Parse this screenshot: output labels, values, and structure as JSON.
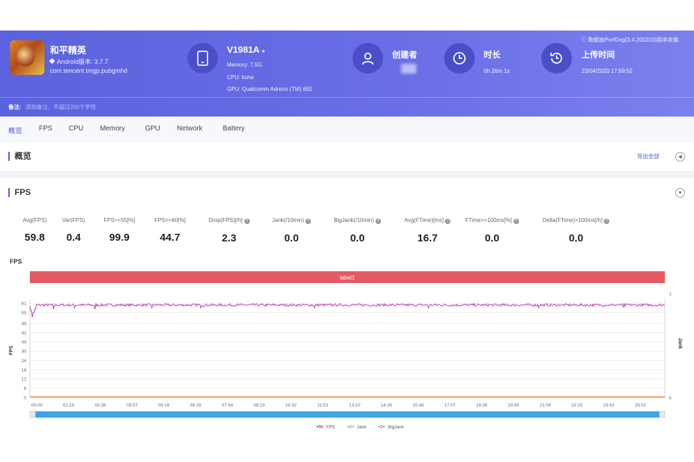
{
  "app": {
    "name": "和平精英",
    "android_version": "Android版本: 3.7.7",
    "package": "com.tencent.tmgp.pubgmhd"
  },
  "device": {
    "name": "V1981A",
    "memory": "Memory: 7.5G",
    "cpu": "CPU: kona",
    "gpu": "GPU: Qualcomm Adreno (TM) 650"
  },
  "creator": {
    "label": "创建者"
  },
  "duration": {
    "label": "时长",
    "value": "0h 26m 1s"
  },
  "upload": {
    "label": "上传时间",
    "value": "22/04/2020 17:59:52"
  },
  "source_note": "数据由PerfDog(3.4.200310)版本收集",
  "remark": {
    "label": "备注:",
    "placeholder": "添加备注，不超过200个字符"
  },
  "tabs": [
    {
      "label": "概览"
    },
    {
      "label": "FPS"
    },
    {
      "label": "CPU"
    },
    {
      "label": "Memory"
    },
    {
      "label": "GPU"
    },
    {
      "label": "Network"
    },
    {
      "label": "Battery"
    }
  ],
  "overview": {
    "title": "概览",
    "export_label": "导出全部"
  },
  "fps_section": {
    "title": "FPS"
  },
  "stats": [
    {
      "label": "Avg(FPS)",
      "value": "59.8",
      "help": false
    },
    {
      "label": "Var(FPS)",
      "value": "0.4",
      "help": false
    },
    {
      "label": "FPS>=55[%]",
      "value": "99.9",
      "help": false
    },
    {
      "label": "FPS>=60[%]",
      "value": "44.7",
      "help": false
    },
    {
      "label": "Drop(FPS)[/h]",
      "value": "2.3",
      "help": true
    },
    {
      "label": "Jank(/10min)",
      "value": "0.0",
      "help": true
    },
    {
      "label": "BigJank(/10min)",
      "value": "0.0",
      "help": true
    },
    {
      "label": "Avg(FTime)[ms]",
      "value": "16.7",
      "help": true
    },
    {
      "label": "FTime>=100ms[%]",
      "value": "0.0",
      "help": true
    },
    {
      "label": "Delta(FTime)>100ms[/h]",
      "value": "0.0",
      "help": true
    }
  ],
  "colors": {
    "accent": "#4a57d8",
    "fps_line": "#c13ab6",
    "jank_line": "#f0a050",
    "bigjank_line": "#c88a8a",
    "label_band": "#e55a64",
    "scrollbar": "#3ca6e6"
  },
  "chart_data": {
    "type": "line",
    "title": "FPS",
    "ylabel": "FPS",
    "y2label": "Jank",
    "band_label": "label1",
    "ylim": [
      0,
      61
    ],
    "y2lim": [
      0,
      1
    ],
    "yticks": [
      0,
      6,
      12,
      18,
      24,
      30,
      36,
      42,
      48,
      55,
      61
    ],
    "y2ticks": [
      0,
      1
    ],
    "xticks": [
      "00:00",
      "01:19",
      "02:38",
      "03:57",
      "05:16",
      "06:35",
      "07:54",
      "09:13",
      "10:32",
      "11:51",
      "13:10",
      "14:29",
      "15:48",
      "17:07",
      "18:26",
      "19:45",
      "21:04",
      "22:23",
      "23:42",
      "25:01"
    ],
    "duration_s": 1561,
    "series": [
      {
        "name": "FPS",
        "base": 59.8,
        "dips": [
          [
            3,
            56
          ],
          [
            6,
            52
          ],
          [
            9,
            55
          ],
          [
            13,
            57
          ],
          [
            58,
            57
          ],
          [
            110,
            58
          ],
          [
            160,
            57
          ],
          [
            300,
            58
          ],
          [
            420,
            58
          ],
          [
            700,
            58
          ],
          [
            980,
            58
          ],
          [
            1250,
            58
          ],
          [
            1460,
            58
          ]
        ]
      },
      {
        "name": "Jank",
        "value": 0
      },
      {
        "name": "BigJank",
        "value": 0
      }
    ],
    "legend": "bottom",
    "grid": true
  }
}
